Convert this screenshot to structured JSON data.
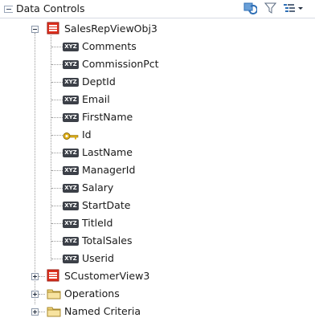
{
  "panel": {
    "title": "Data Controls",
    "tools": [
      "refresh-icon",
      "filter-icon",
      "view-options-icon"
    ]
  },
  "tree": {
    "root": {
      "label": "SalesRepViewObj3",
      "icon": "view-object-icon"
    },
    "attributes": [
      {
        "label": "Comments",
        "icon": "attribute-icon"
      },
      {
        "label": "CommissionPct",
        "icon": "attribute-icon"
      },
      {
        "label": "DeptId",
        "icon": "attribute-icon"
      },
      {
        "label": "Email",
        "icon": "attribute-icon"
      },
      {
        "label": "FirstName",
        "icon": "attribute-icon"
      },
      {
        "label": "Id",
        "icon": "key-attribute-icon"
      },
      {
        "label": "LastName",
        "icon": "attribute-icon"
      },
      {
        "label": "ManagerId",
        "icon": "attribute-icon"
      },
      {
        "label": "Salary",
        "icon": "attribute-icon"
      },
      {
        "label": "StartDate",
        "icon": "attribute-icon"
      },
      {
        "label": "TitleId",
        "icon": "attribute-icon"
      },
      {
        "label": "TotalSales",
        "icon": "attribute-icon"
      },
      {
        "label": "Userid",
        "icon": "attribute-icon"
      }
    ],
    "attribute_icon_text": "XYZ",
    "children": [
      {
        "label": "SCustomerView3",
        "icon": "view-object-icon"
      },
      {
        "label": "Operations",
        "icon": "folder-icon"
      },
      {
        "label": "Named Criteria",
        "icon": "folder-icon"
      }
    ]
  },
  "colors": {
    "accent_blue": "#2f6fb5",
    "view_object_red": "#e0301e",
    "folder_yellow": "#f2d57a",
    "key_gold": "#e2b21a"
  }
}
